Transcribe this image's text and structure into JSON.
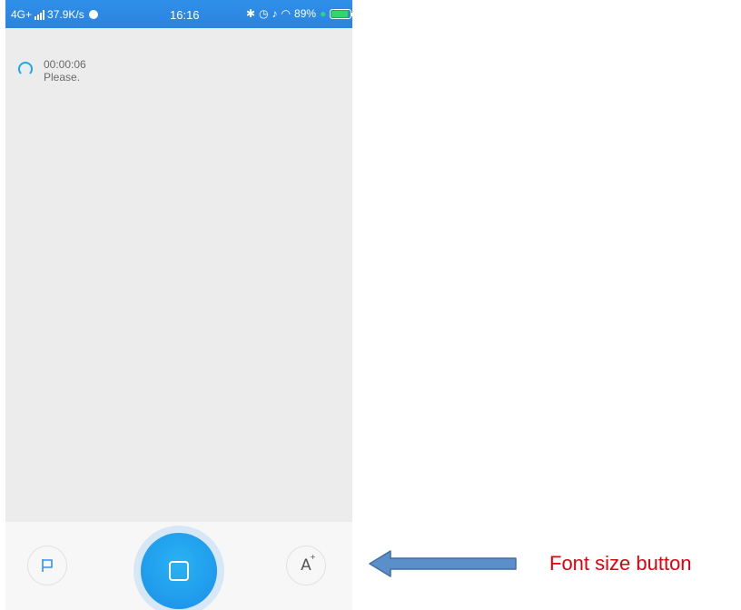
{
  "status_bar": {
    "network": "4G+",
    "speed": "37.9K/s",
    "time": "16:16",
    "icons_right": [
      "bluetooth-icon",
      "alarm-icon",
      "silent-icon",
      "wifi-icon"
    ],
    "battery": "89%",
    "battery_level": 0.89,
    "background_color": "#2d8ae4"
  },
  "transcript": {
    "timestamp": "00:00:06",
    "text": "Please.",
    "status_icon": "loading-spinner-icon",
    "accent_color": "#1aa8f0"
  },
  "toolbar": {
    "flag_icon": "flag-icon",
    "record_icon": "stop-icon",
    "record_color": "#1a9be8",
    "font_size_label": "A",
    "font_size_superscript": "+"
  },
  "annotation": {
    "label": "Font size button",
    "label_color": "#e0000b",
    "arrow_color": "#5b8fc9",
    "arrow_icon": "left-arrow-icon"
  }
}
